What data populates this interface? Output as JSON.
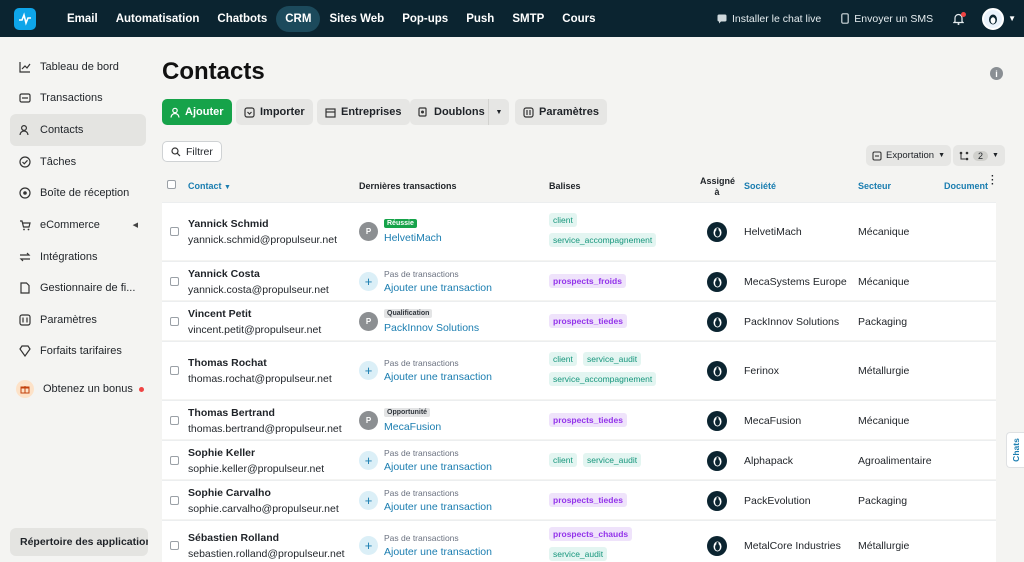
{
  "colors": {
    "nav_bg": "#0b2430",
    "primary": "#16a34a",
    "link": "#1a7db0",
    "tag_teal": "#16967c",
    "tag_purple": "#9333ea"
  },
  "topnav": {
    "items": [
      "Email",
      "Automatisation",
      "Chatbots",
      "CRM",
      "Sites Web",
      "Pop-ups",
      "Push",
      "SMTP",
      "Cours"
    ],
    "active": "CRM",
    "install_chat": "Installer le chat live",
    "send_sms": "Envoyer un SMS"
  },
  "sidebar": {
    "items": [
      {
        "label": "Tableau de bord",
        "icon": "chart-icon"
      },
      {
        "label": "Transactions",
        "icon": "transactions-icon"
      },
      {
        "label": "Contacts",
        "icon": "contacts-icon"
      },
      {
        "label": "Tâches",
        "icon": "tasks-icon"
      },
      {
        "label": "Boîte de réception",
        "icon": "inbox-icon"
      },
      {
        "label": "eCommerce",
        "icon": "cart-icon"
      },
      {
        "label": "Intégrations",
        "icon": "integrations-icon"
      },
      {
        "label": "Gestionnaire de fi...",
        "icon": "files-icon"
      },
      {
        "label": "Paramètres",
        "icon": "settings-icon"
      },
      {
        "label": "Forfaits tarifaires",
        "icon": "plans-icon"
      }
    ],
    "bonus": "Obtenez un bonus",
    "apps_directory": "Répertoire des applications"
  },
  "page": {
    "title": "Contacts",
    "buttons": {
      "add": "Ajouter",
      "import": "Importer",
      "companies": "Entreprises",
      "duplicates": "Doublons",
      "settings": "Paramètres"
    },
    "filter": "Filtrer",
    "export": "Exportation",
    "group_count": "2"
  },
  "table": {
    "headers": {
      "contact": "Contact",
      "deals": "Dernières transactions",
      "tags": "Balises",
      "assigned_1": "Assigné",
      "assigned_2": "à",
      "company": "Société",
      "sector": "Secteur",
      "document": "Document"
    },
    "no_deal_text": "Pas de transactions",
    "add_deal_text": "Ajouter une transaction",
    "rows": [
      {
        "name": "Yannick Schmid",
        "email": "yannick.schmid@propulseur.net",
        "deal_stage": "Réussie",
        "deal_name": "HelvetiMach",
        "tags": [
          "client",
          "service_accompagnement"
        ],
        "company": "HelvetiMach",
        "sector": "Mécanique"
      },
      {
        "name": "Yannick Costa",
        "email": "yannick.costa@propulseur.net",
        "deal_stage": "",
        "deal_name": "",
        "tags": [
          "prospects_froids"
        ],
        "company": "MecaSystems Europe",
        "sector": "Mécanique"
      },
      {
        "name": "Vincent Petit",
        "email": "vincent.petit@propulseur.net",
        "deal_stage": "Qualification",
        "deal_name": "PackInnov Solutions",
        "tags": [
          "prospects_tiedes"
        ],
        "company": "PackInnov Solutions",
        "sector": "Packaging"
      },
      {
        "name": "Thomas Rochat",
        "email": "thomas.rochat@propulseur.net",
        "deal_stage": "",
        "deal_name": "",
        "tags": [
          "client",
          "service_audit",
          "service_accompagnement"
        ],
        "company": "Ferinox",
        "sector": "Métallurgie"
      },
      {
        "name": "Thomas Bertrand",
        "email": "thomas.bertrand@propulseur.net",
        "deal_stage": "Opportunité",
        "deal_name": "MecaFusion",
        "tags": [
          "prospects_tiedes"
        ],
        "company": "MecaFusion",
        "sector": "Mécanique"
      },
      {
        "name": "Sophie Keller",
        "email": "sophie.keller@propulseur.net",
        "deal_stage": "",
        "deal_name": "",
        "tags": [
          "client",
          "service_audit"
        ],
        "company": "Alphapack",
        "sector": "Agroalimentaire"
      },
      {
        "name": "Sophie Carvalho",
        "email": "sophie.carvalho@propulseur.net",
        "deal_stage": "",
        "deal_name": "",
        "tags": [
          "prospects_tiedes"
        ],
        "company": "PackEvolution",
        "sector": "Packaging"
      },
      {
        "name": "Sébastien Rolland",
        "email": "sebastien.rolland@propulseur.net",
        "deal_stage": "",
        "deal_name": "",
        "tags": [
          "prospects_chauds",
          "service_audit"
        ],
        "company": "MetalCore Industries",
        "sector": "Métallurgie"
      }
    ]
  },
  "chats_tab": "Chats"
}
